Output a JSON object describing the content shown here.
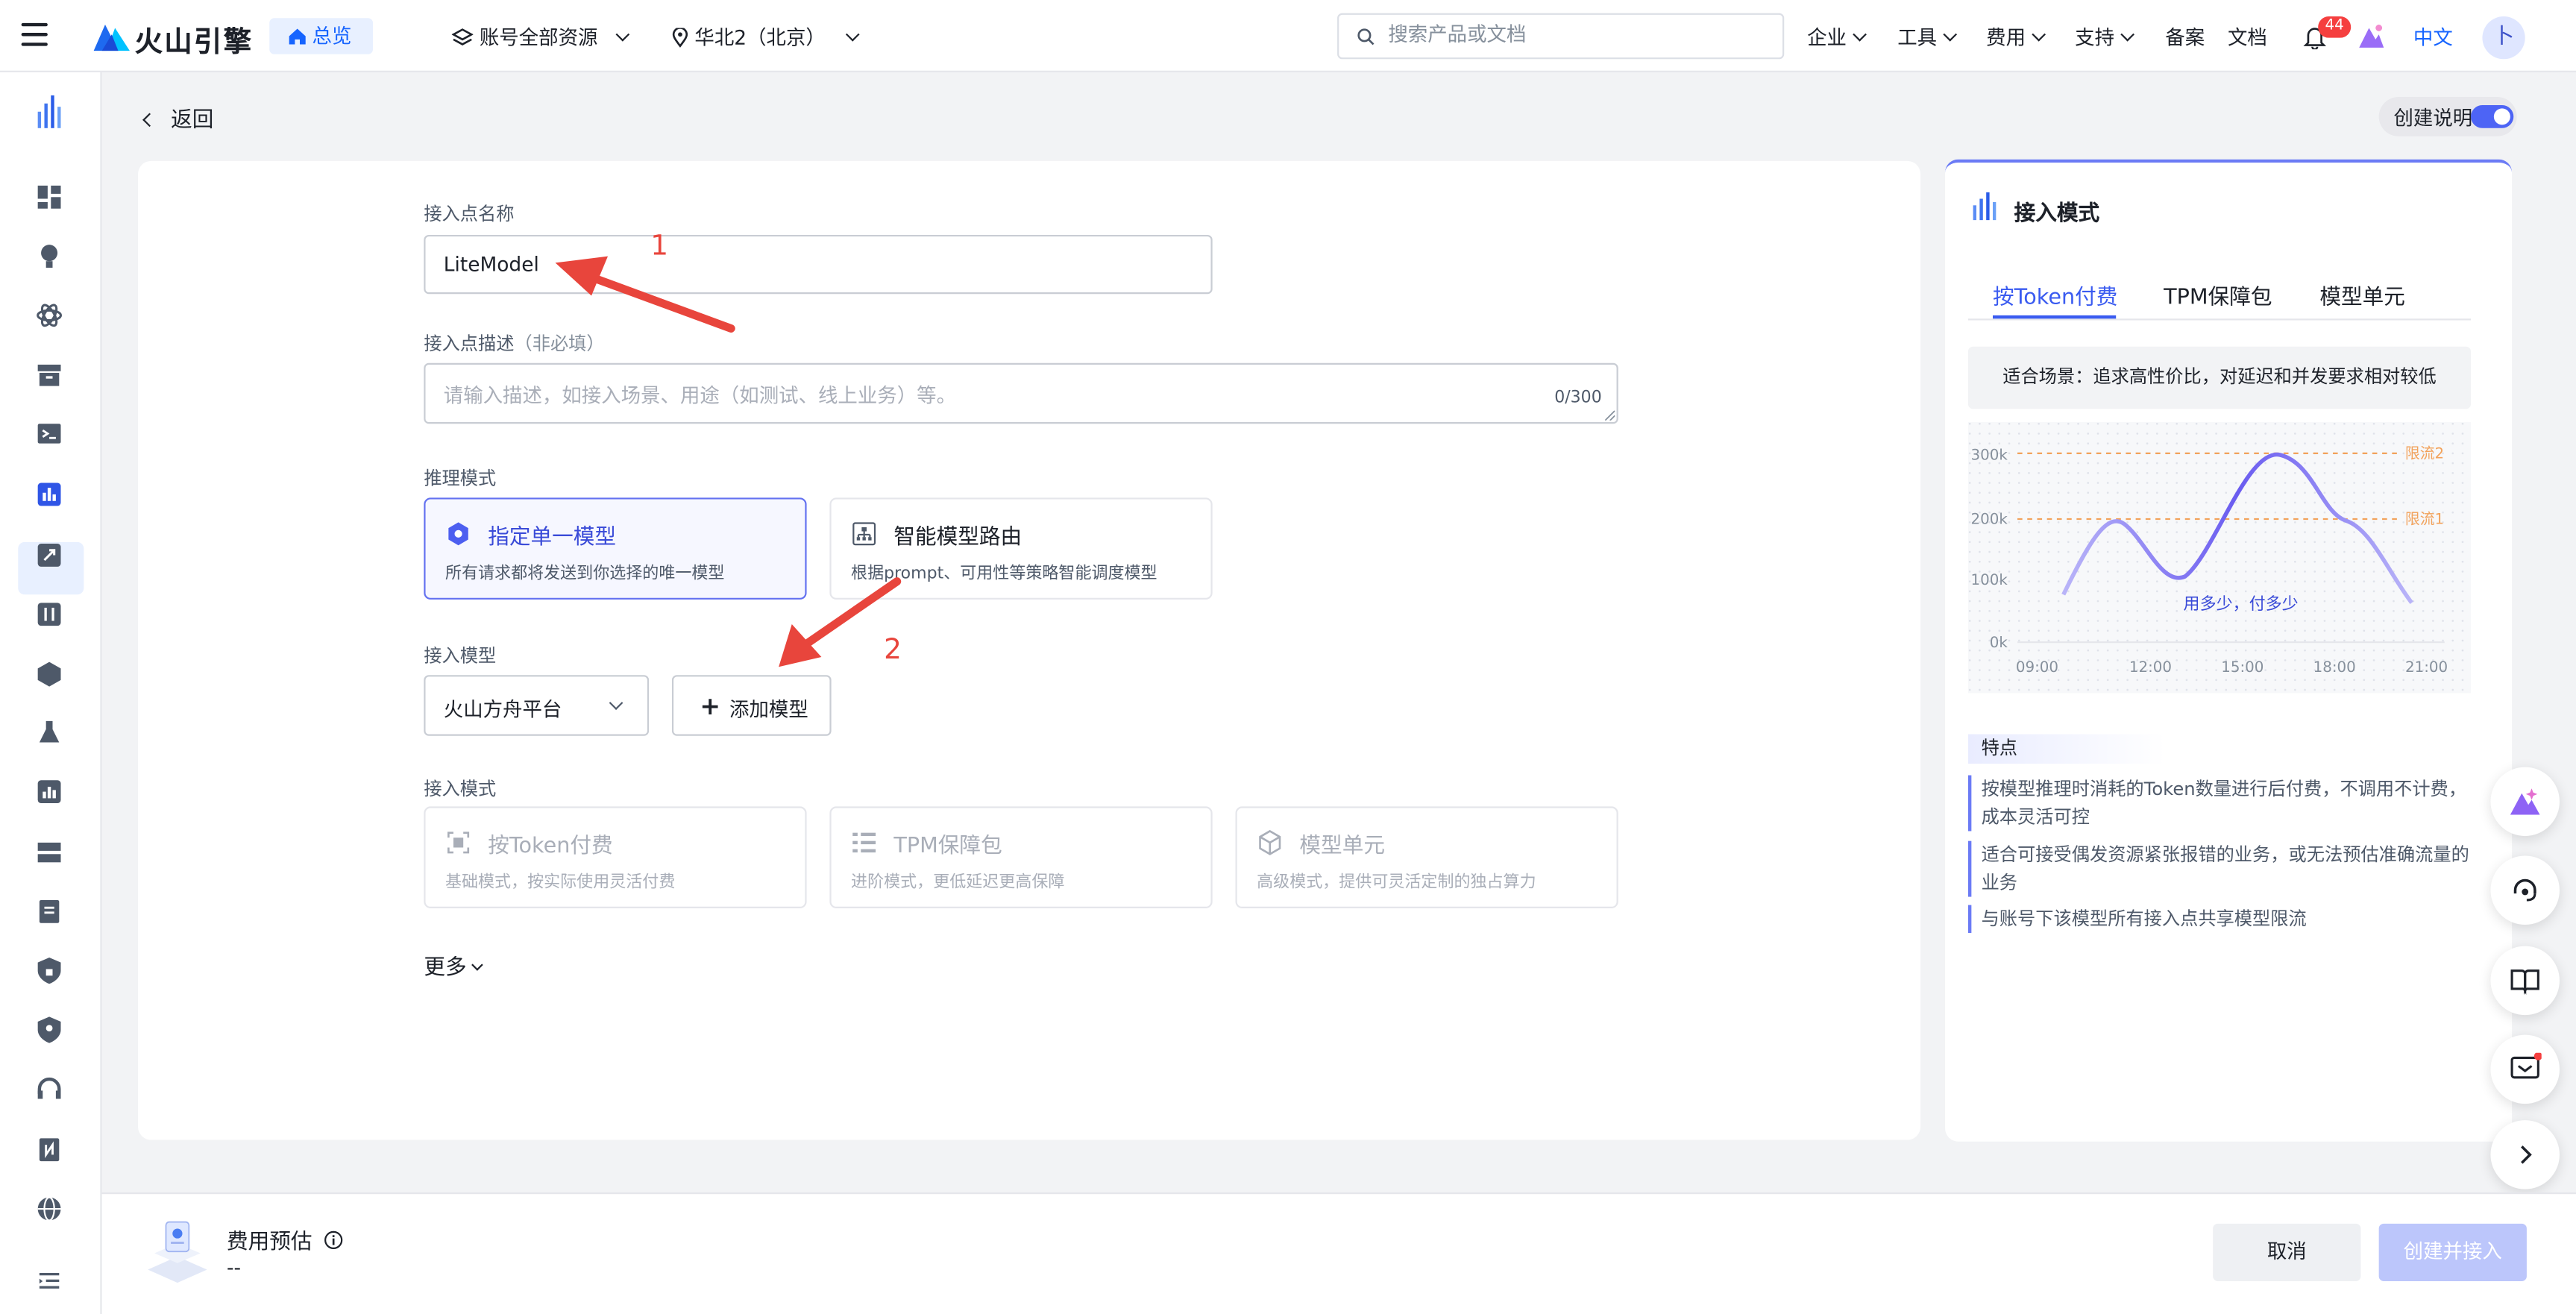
{
  "topbar": {
    "logo_text": "火山引擎",
    "overview_label": "总览",
    "account_resources": "账号全部资源",
    "region": "华北2（北京）",
    "search_placeholder": "搜索产品或文档",
    "menu": [
      "企业",
      "工具",
      "费用",
      "支持",
      "备案",
      "文档"
    ],
    "notification_count": "44",
    "language": "中文",
    "avatar_initial": "卜"
  },
  "page": {
    "back_label": "返回",
    "guide_toggle_label": "创建说明"
  },
  "form": {
    "name_label": "接入点名称",
    "name_value": "LiteModel",
    "desc_label": "接入点描述",
    "desc_optional": "（非必填）",
    "desc_placeholder": "请输入描述，如接入场景、用途（如测试、线上业务）等。",
    "desc_counter": "0/300",
    "inference_mode_label": "推理模式",
    "inference_modes": [
      {
        "title": "指定单一模型",
        "desc": "所有请求都将发送到你选择的唯一模型"
      },
      {
        "title": "智能模型路由",
        "desc": "根据prompt、可用性等策略智能调度模型"
      }
    ],
    "model_label": "接入模型",
    "model_platform": "火山方舟平台",
    "add_model_label": "添加模型",
    "access_mode_label": "接入模式",
    "access_modes": [
      {
        "title": "按Token付费",
        "desc": "基础模式，按实际使用灵活付费"
      },
      {
        "title": "TPM保障包",
        "desc": "进阶模式，更低延迟更高保障"
      },
      {
        "title": "模型单元",
        "desc": "高级模式，提供可灵活定制的独占算力"
      }
    ],
    "more_label": "更多"
  },
  "annotations": [
    "1",
    "2"
  ],
  "side_panel": {
    "title": "接入模式",
    "tabs": [
      "按Token付费",
      "TPM保障包",
      "模型单元"
    ],
    "scene": "适合场景：追求高性价比，对延迟和并发要求相对较低",
    "chart": {
      "y_ticks": [
        "300k",
        "200k",
        "100k",
        "0k"
      ],
      "x_ticks": [
        "09:00",
        "12:00",
        "15:00",
        "18:00",
        "21:00"
      ],
      "limit2": "限流2",
      "limit1": "限流1",
      "caption": "用多少，付多少"
    },
    "features_title": "特点",
    "features": [
      "按模型推理时消耗的Token数量进行后付费，不调用不计费，成本灵活可控",
      "适合可接受偶发资源紧张报错的业务，或无法预估准确流量的业务",
      "与账号下该模型所有接入点共享模型限流"
    ]
  },
  "footer": {
    "fee_title": "费用预估",
    "fee_value": "--",
    "cancel_label": "取消",
    "create_label": "创建并接入"
  },
  "colors": {
    "accent": "#3a5bf0",
    "annotation_red": "#e8453c"
  }
}
